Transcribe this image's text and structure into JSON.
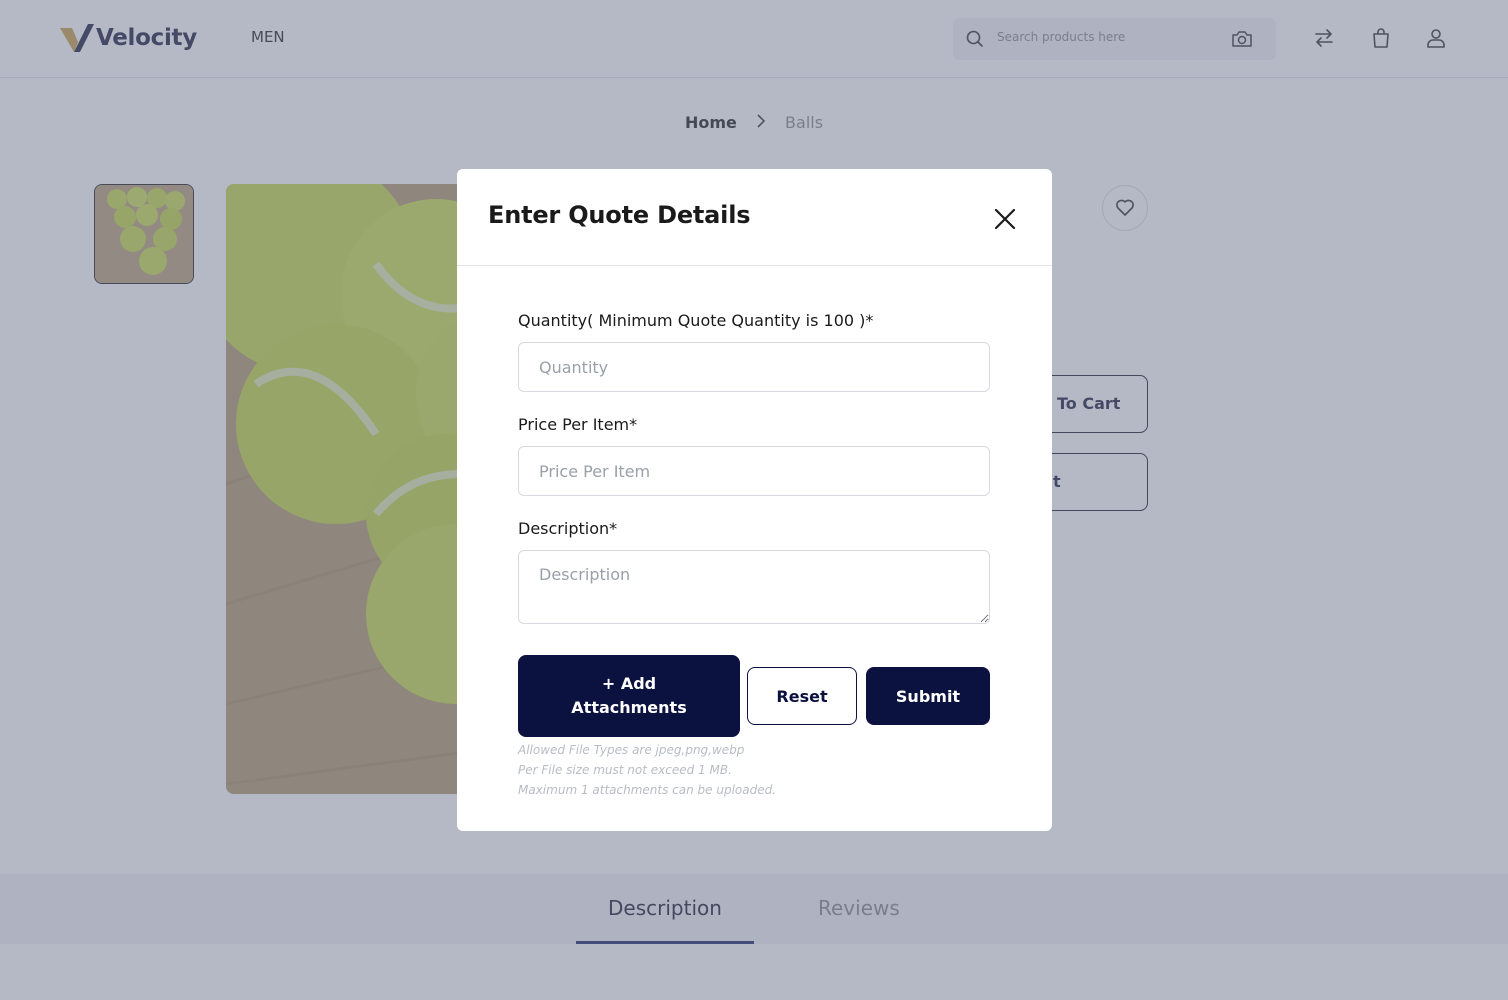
{
  "header": {
    "brand": "Velocity",
    "nav": [
      "MEN"
    ],
    "search_placeholder": "Search products here",
    "icons": [
      "search-icon",
      "camera-icon",
      "compare-icon",
      "cart-icon",
      "user-icon"
    ]
  },
  "breadcrumb": {
    "home": "Home",
    "current": "Balls"
  },
  "product": {
    "add_to_cart_partial": "To Cart",
    "second_button_partial": "t"
  },
  "tabs": {
    "description": "Description",
    "reviews": "Reviews"
  },
  "modal": {
    "title": "Enter Quote Details",
    "quantity_label": "Quantity( Minimum Quote Quantity is 100 )*",
    "quantity_placeholder": "Quantity",
    "price_label": "Price Per Item*",
    "price_placeholder": "Price Per Item",
    "description_label": "Description*",
    "description_placeholder": "Description",
    "add_attachments": "+ Add Attachments",
    "reset": "Reset",
    "submit": "Submit",
    "notes": [
      "Allowed File Types are jpeg,png,webp",
      "Per File size must not exceed 1 MB.",
      "Maximum 1 attachments can be uploaded."
    ]
  },
  "colors": {
    "primary": "#0c1240",
    "overlay": "#6b728c",
    "logo_gold": "#c9a14a",
    "logo_navy": "#1c2340"
  }
}
